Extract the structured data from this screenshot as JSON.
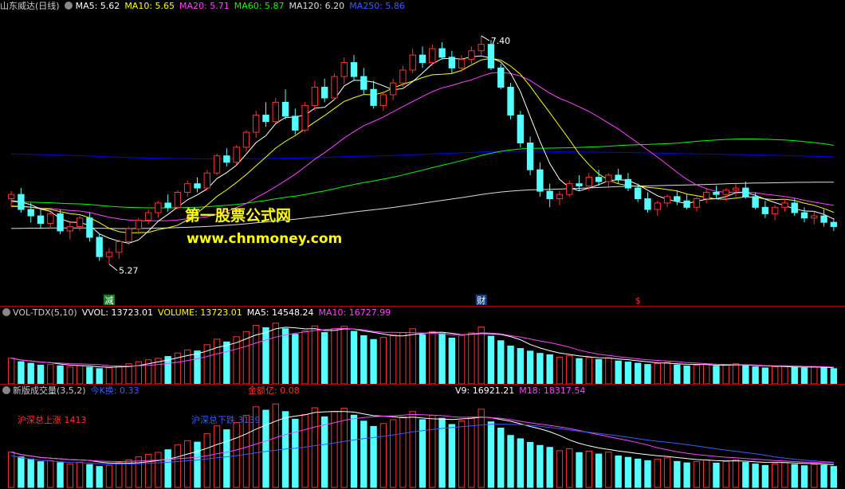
{
  "colors": {
    "bg": "#000000",
    "up": "#ff3232",
    "down": "#54ffff",
    "ma5": "#ffffff",
    "ma10": "#ffff00",
    "ma20": "#ff44ff",
    "ma60": "#00ff00",
    "ma120": "#dddddd",
    "ma250": "#0000ff",
    "divider": "#aa0000"
  },
  "main": {
    "title": "山东威达(日线)",
    "ma5": "MA5: 5.62",
    "ma10": "MA10: 5.65",
    "ma20": "MA20: 5.71",
    "ma60": "MA60: 5.87",
    "ma120": "MA120: 6.20",
    "ma250": "MA250: 5.86",
    "high_label": "7.40",
    "low_label": "5.27",
    "marker_1": "减",
    "marker_2": "财",
    "marker_3": "$",
    "watermark_1": "第一股票公式网",
    "watermark_2": "www.chnmoney.com"
  },
  "vol": {
    "name": "VOL-TDX(5,10)",
    "vvol": "VVOL: 13723.01",
    "volume": "VOLUME: 13723.01",
    "ma5": "MA5: 14548.24",
    "ma10": "MA10: 16727.99"
  },
  "ind": {
    "name": "新版成交量(3,5,2)",
    "k": "今K换: 0.33",
    "amount": "金额亿: 0.08",
    "v9": "V9: 16921.21",
    "m18": "M18: 18317.54",
    "note_up": "沪深总上涨 1413",
    "note_down": "沪深总下跌 3139"
  },
  "chart_data": [
    {
      "type": "candlestick",
      "title": "山东威达(日线)",
      "annotations": [
        "7.40",
        "5.27"
      ],
      "ylim": [
        5.0,
        7.6
      ],
      "series_names": [
        "MA5",
        "MA10",
        "MA20",
        "MA60",
        "MA120",
        "MA250"
      ],
      "ohlc": [
        [
          5.88,
          5.95,
          5.8,
          5.92
        ],
        [
          5.92,
          5.98,
          5.75,
          5.78
        ],
        [
          5.78,
          5.84,
          5.66,
          5.72
        ],
        [
          5.72,
          5.78,
          5.6,
          5.65
        ],
        [
          5.65,
          5.76,
          5.6,
          5.74
        ],
        [
          5.74,
          5.78,
          5.55,
          5.58
        ],
        [
          5.58,
          5.66,
          5.5,
          5.62
        ],
        [
          5.62,
          5.72,
          5.58,
          5.7
        ],
        [
          5.7,
          5.75,
          5.48,
          5.52
        ],
        [
          5.52,
          5.56,
          5.3,
          5.34
        ],
        [
          5.34,
          5.42,
          5.27,
          5.38
        ],
        [
          5.38,
          5.5,
          5.32,
          5.48
        ],
        [
          5.48,
          5.62,
          5.45,
          5.6
        ],
        [
          5.6,
          5.7,
          5.55,
          5.68
        ],
        [
          5.68,
          5.78,
          5.64,
          5.75
        ],
        [
          5.75,
          5.86,
          5.7,
          5.84
        ],
        [
          5.84,
          5.92,
          5.76,
          5.8
        ],
        [
          5.8,
          5.96,
          5.78,
          5.94
        ],
        [
          5.94,
          6.05,
          5.9,
          6.02
        ],
        [
          6.02,
          6.08,
          5.94,
          5.98
        ],
        [
          5.98,
          6.15,
          5.96,
          6.12
        ],
        [
          6.12,
          6.3,
          6.1,
          6.28
        ],
        [
          6.28,
          6.35,
          6.18,
          6.22
        ],
        [
          6.22,
          6.38,
          6.2,
          6.36
        ],
        [
          6.36,
          6.52,
          6.32,
          6.5
        ],
        [
          6.5,
          6.7,
          6.45,
          6.66
        ],
        [
          6.66,
          6.78,
          6.55,
          6.6
        ],
        [
          6.6,
          6.82,
          6.58,
          6.78
        ],
        [
          6.78,
          6.9,
          6.62,
          6.65
        ],
        [
          6.65,
          6.72,
          6.48,
          6.52
        ],
        [
          6.52,
          6.78,
          6.5,
          6.75
        ],
        [
          6.75,
          6.98,
          6.7,
          6.92
        ],
        [
          6.92,
          7.0,
          6.78,
          6.82
        ],
        [
          6.82,
          7.05,
          6.8,
          7.02
        ],
        [
          7.02,
          7.2,
          6.95,
          7.15
        ],
        [
          7.15,
          7.22,
          6.98,
          7.02
        ],
        [
          7.02,
          7.1,
          6.85,
          6.9
        ],
        [
          6.9,
          6.98,
          6.72,
          6.75
        ],
        [
          6.75,
          6.88,
          6.7,
          6.85
        ],
        [
          6.85,
          7.0,
          6.8,
          6.96
        ],
        [
          6.96,
          7.12,
          6.92,
          7.08
        ],
        [
          7.08,
          7.28,
          7.05,
          7.22
        ],
        [
          7.22,
          7.3,
          7.1,
          7.15
        ],
        [
          7.15,
          7.32,
          7.12,
          7.28
        ],
        [
          7.28,
          7.34,
          7.18,
          7.2
        ],
        [
          7.2,
          7.26,
          7.05,
          7.1
        ],
        [
          7.1,
          7.22,
          7.06,
          7.18
        ],
        [
          7.18,
          7.3,
          7.14,
          7.26
        ],
        [
          7.26,
          7.4,
          7.22,
          7.32
        ],
        [
          7.32,
          7.36,
          7.08,
          7.1
        ],
        [
          7.1,
          7.14,
          6.9,
          6.92
        ],
        [
          6.92,
          6.96,
          6.62,
          6.66
        ],
        [
          6.66,
          6.7,
          6.36,
          6.4
        ],
        [
          6.4,
          6.46,
          6.1,
          6.15
        ],
        [
          6.15,
          6.22,
          5.9,
          5.95
        ],
        [
          5.95,
          6.02,
          5.8,
          5.88
        ],
        [
          5.88,
          5.95,
          5.82,
          5.92
        ],
        [
          5.92,
          6.05,
          5.9,
          6.02
        ],
        [
          6.02,
          6.1,
          5.95,
          6.0
        ],
        [
          6.0,
          6.12,
          5.96,
          6.08
        ],
        [
          6.08,
          6.15,
          6.0,
          6.04
        ],
        [
          6.04,
          6.12,
          5.98,
          6.1
        ],
        [
          6.1,
          6.16,
          6.02,
          6.06
        ],
        [
          6.06,
          6.12,
          5.95,
          5.98
        ],
        [
          5.98,
          6.02,
          5.85,
          5.88
        ],
        [
          5.88,
          5.94,
          5.75,
          5.78
        ],
        [
          5.78,
          5.86,
          5.72,
          5.84
        ],
        [
          5.84,
          5.92,
          5.8,
          5.9
        ],
        [
          5.9,
          5.96,
          5.82,
          5.86
        ],
        [
          5.86,
          5.92,
          5.78,
          5.8
        ],
        [
          5.8,
          5.9,
          5.76,
          5.88
        ],
        [
          5.88,
          5.98,
          5.84,
          5.94
        ],
        [
          5.94,
          6.0,
          5.88,
          5.92
        ],
        [
          5.92,
          5.98,
          5.86,
          5.96
        ],
        [
          5.96,
          6.02,
          5.9,
          5.98
        ],
        [
          5.98,
          6.04,
          5.88,
          5.9
        ],
        [
          5.9,
          5.94,
          5.78,
          5.8
        ],
        [
          5.8,
          5.86,
          5.7,
          5.74
        ],
        [
          5.74,
          5.82,
          5.68,
          5.8
        ],
        [
          5.8,
          5.88,
          5.76,
          5.84
        ],
        [
          5.84,
          5.88,
          5.72,
          5.75
        ],
        [
          5.75,
          5.8,
          5.66,
          5.7
        ],
        [
          5.7,
          5.76,
          5.64,
          5.72
        ],
        [
          5.72,
          5.78,
          5.62,
          5.66
        ],
        [
          5.66,
          5.7,
          5.58,
          5.62
        ]
      ]
    },
    {
      "type": "bar",
      "title": "VOL-TDX(5,10)",
      "series_names": [
        "VOLUME",
        "MA5",
        "MA10"
      ],
      "values": [
        14800,
        12800,
        11900,
        10800,
        11200,
        10400,
        9800,
        10600,
        9600,
        8800,
        9300,
        10400,
        11600,
        12800,
        13900,
        14700,
        15800,
        17800,
        19600,
        19000,
        22600,
        25800,
        24200,
        27200,
        30200,
        33800,
        32400,
        35000,
        31800,
        28600,
        30600,
        33400,
        29600,
        31800,
        33200,
        30300,
        27800,
        25600,
        26800,
        28400,
        29600,
        31800,
        28400,
        30200,
        29000,
        26400,
        27900,
        29400,
        32800,
        27500,
        24900,
        21800,
        20400,
        18900,
        17600,
        16800,
        15400,
        16200,
        14600,
        15200,
        14000,
        14800,
        13200,
        12600,
        11900,
        11200,
        11800,
        12400,
        10900,
        10300,
        10800,
        11500,
        10200,
        10900,
        11600,
        10500,
        9800,
        9200,
        9900,
        10400,
        9600,
        9100,
        9700,
        9300,
        8800
      ]
    },
    {
      "type": "bar",
      "title": "新版成交量(3,5,2)",
      "series_names": [
        "V9",
        "M18"
      ],
      "values": [
        14800,
        12800,
        11900,
        10800,
        11200,
        10400,
        9800,
        10600,
        9600,
        8800,
        9300,
        10400,
        11600,
        12800,
        13900,
        14700,
        15800,
        17800,
        19600,
        19000,
        22600,
        25800,
        24200,
        27200,
        30200,
        33800,
        32400,
        35000,
        31800,
        28600,
        30600,
        33400,
        29600,
        31800,
        33200,
        30300,
        27800,
        25600,
        26800,
        28400,
        29600,
        31800,
        28400,
        30200,
        29000,
        26400,
        27900,
        29400,
        32800,
        27500,
        24900,
        21800,
        20400,
        18900,
        17600,
        16800,
        15400,
        16200,
        14600,
        15200,
        14000,
        14800,
        13200,
        12600,
        11900,
        11200,
        11800,
        12400,
        10900,
        10300,
        10800,
        11500,
        10200,
        10900,
        11600,
        10500,
        9800,
        9200,
        9900,
        10400,
        9600,
        9100,
        9700,
        9300,
        8800
      ]
    }
  ]
}
